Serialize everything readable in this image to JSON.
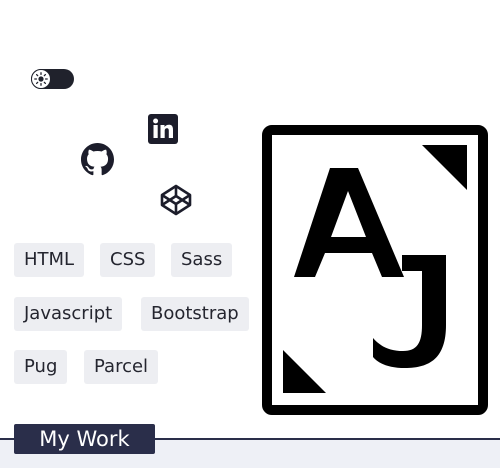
{
  "theme_toggle": {
    "icon": "sun-icon",
    "state": "light"
  },
  "social_links": [
    {
      "name": "linkedin",
      "icon": "linkedin-icon"
    },
    {
      "name": "github",
      "icon": "github-icon"
    },
    {
      "name": "codepen",
      "icon": "codepen-icon"
    }
  ],
  "skills": [
    "HTML",
    "CSS",
    "Sass",
    "Javascript",
    "Bootstrap",
    "Pug",
    "Parcel"
  ],
  "logo": {
    "letters": "AJ",
    "icon": "aj-monogram-logo"
  },
  "section": {
    "title": "My Work"
  },
  "colors": {
    "ink": "#1c1d2b",
    "chip_bg": "#edeef2",
    "section_bg": "#2a2e4a",
    "section_band": "#eef0f6"
  }
}
